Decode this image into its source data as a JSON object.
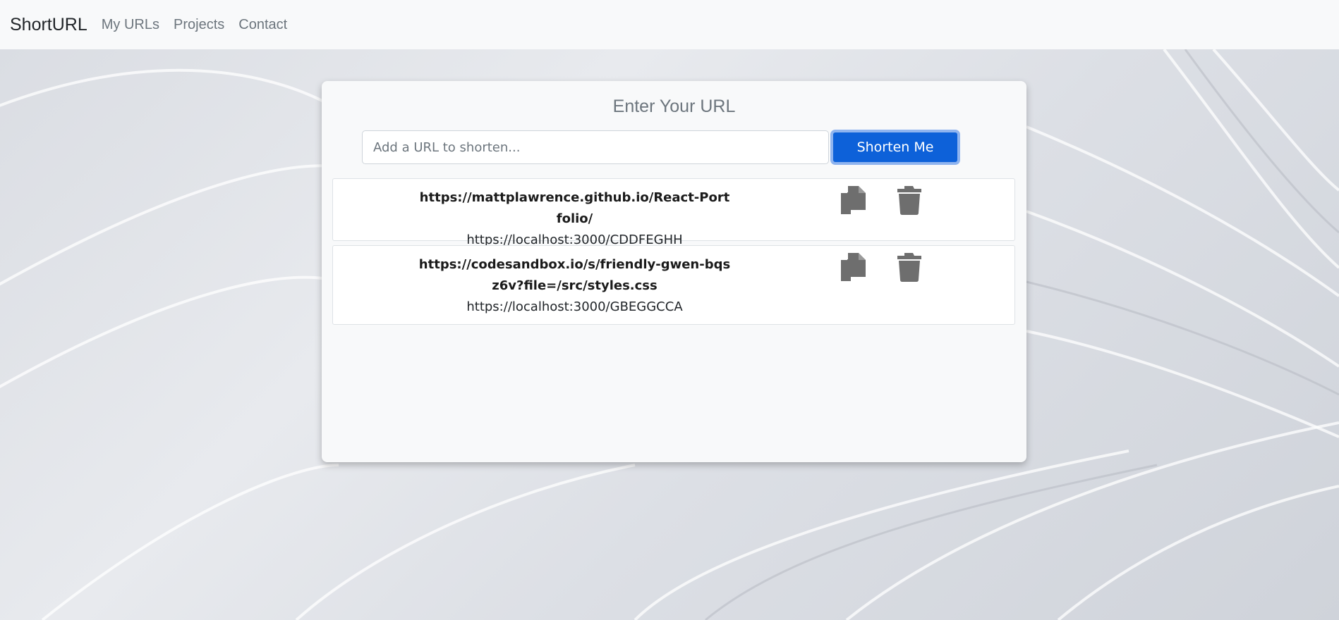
{
  "navbar": {
    "brand": "ShortURL",
    "links": [
      "My URLs",
      "Projects",
      "Contact"
    ]
  },
  "main": {
    "title": "Enter Your URL",
    "input_placeholder": "Add a URL to shorten...",
    "input_value": "",
    "button_label": "Shorten Me"
  },
  "urls": [
    {
      "original": "https://mattplawrence.github.io/React-Portfolio/",
      "short": "https://localhost:3000/CDDFEGHH"
    },
    {
      "original": "https://codesandbox.io/s/friendly-gwen-bqsz6v?file=/src/styles.css",
      "short": "https://localhost:3000/GBEGGCCA"
    }
  ],
  "icons": {
    "copy": "copy-icon",
    "delete": "trash-icon"
  },
  "colors": {
    "primary": "#0d61d9",
    "icon": "#6e6e6e",
    "navbar_bg": "#f8f9fa"
  }
}
